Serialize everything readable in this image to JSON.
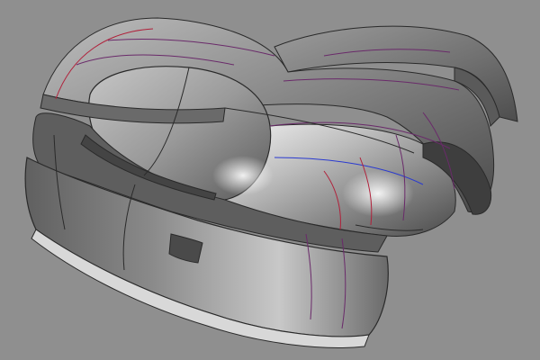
{
  "viewport": {
    "background": "#8f8f8f",
    "model": "car-body-shell",
    "render": "shaded-with-isocurves"
  },
  "colors": {
    "surface_dark": "#3c3c3c",
    "surface_mid": "#7a7a7a",
    "surface_light": "#dcdcdc",
    "highlight": "#ffffff",
    "edge": "#2a2a2a",
    "curve_purple": "#6a2a6a",
    "curve_red": "#b0203a",
    "curve_blue": "#2a3ad0"
  }
}
